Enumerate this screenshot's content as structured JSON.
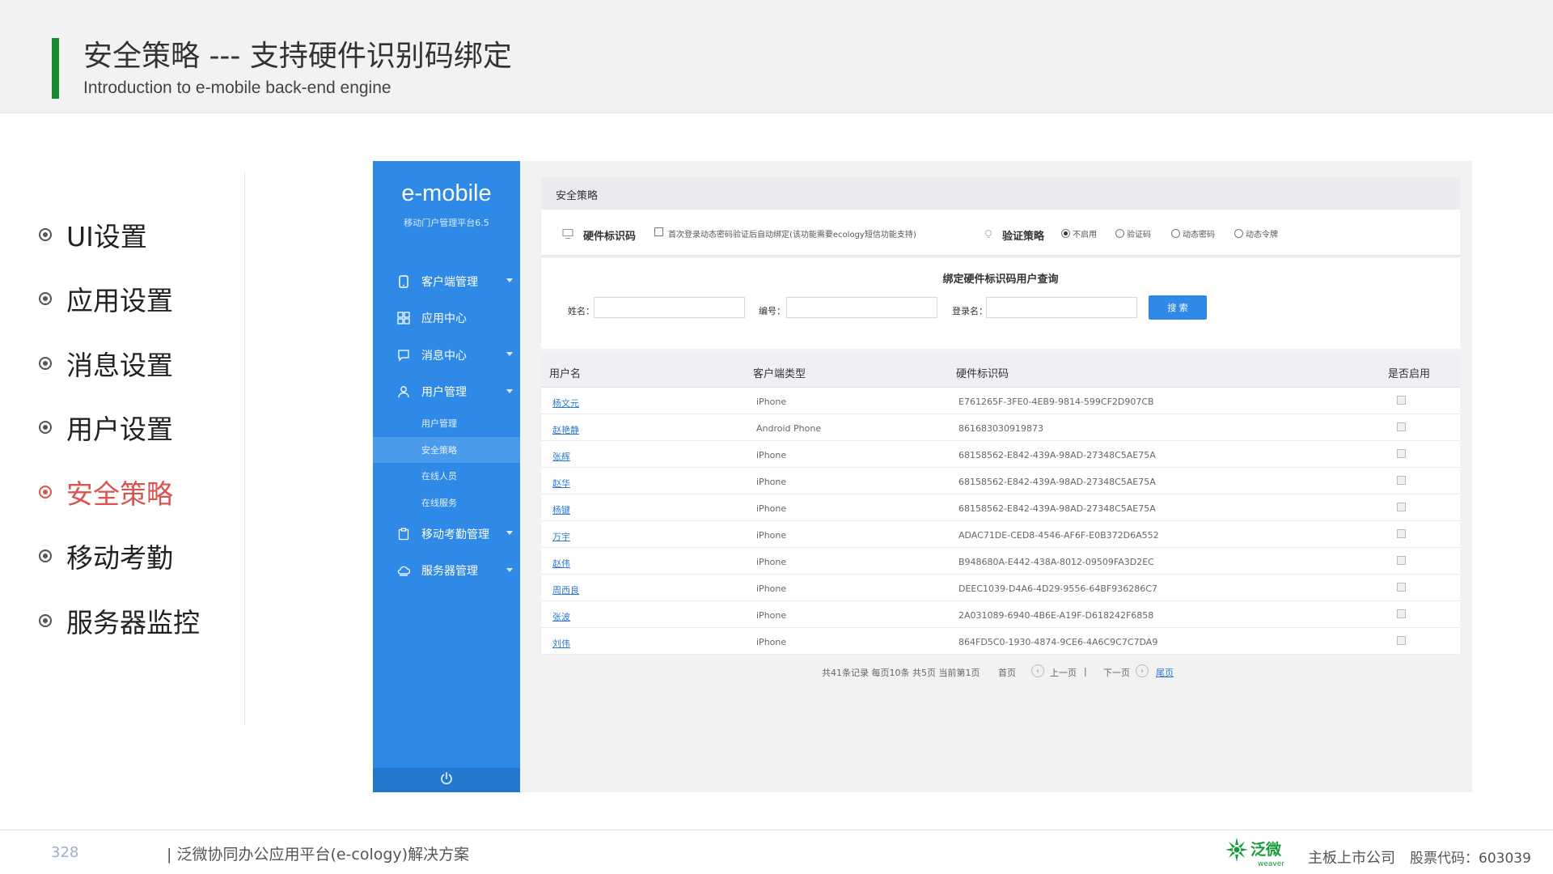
{
  "header": {
    "title": "安全策略 --- 支持硬件识别码绑定",
    "subtitle": "Introduction to e-mobile back-end engine",
    "accent_color": "#1a8a2e"
  },
  "left_nav": {
    "items": [
      {
        "label": "UI设置",
        "active": false
      },
      {
        "label": "应用设置",
        "active": false
      },
      {
        "label": "消息设置",
        "active": false
      },
      {
        "label": "用户设置",
        "active": false
      },
      {
        "label": "安全策略",
        "active": true
      },
      {
        "label": "移动考勤",
        "active": false
      },
      {
        "label": "服务器监控",
        "active": false
      }
    ],
    "active_color": "#d9534f"
  },
  "app": {
    "brand": "e-mobile",
    "brand_sub": "移动门户管理平台6.5",
    "sidebar_color": "#2e8ae6",
    "menu": {
      "client_mgmt": "客户端管理",
      "app_center": "应用中心",
      "msg_center": "消息中心",
      "user_mgmt": "用户管理",
      "sub_user_mgmt": "用户管理",
      "sub_security": "安全策略",
      "sub_online_users": "在线人员",
      "sub_online_service": "在线服务",
      "attendance_mgmt": "移动考勤管理",
      "server_mgmt": "服务器管理"
    },
    "breadcrumb": "安全策略",
    "settings": {
      "hw_label": "硬件标识码",
      "hw_checkbox_text": "首次登录动态密码验证后自动绑定(该功能需要ecology短信功能支持)",
      "verify_label": "验证策略",
      "options": [
        "不启用",
        "验证码",
        "动态密码",
        "动态令牌"
      ],
      "selected_option": "不启用"
    },
    "search": {
      "title": "绑定硬件标识码用户查询",
      "name_label": "姓名：",
      "number_label": "编号：",
      "login_label": "登录名：",
      "button": "搜 索"
    },
    "table": {
      "columns": [
        "用户名",
        "客户端类型",
        "硬件标识码",
        "是否启用"
      ],
      "rows": [
        {
          "user": "杨文元",
          "type": "iPhone",
          "code": "E761265F-3FE0-4EB9-9814-599CF2D907CB"
        },
        {
          "user": "赵艳静",
          "type": "Android Phone",
          "code": "861683030919873"
        },
        {
          "user": "张辉",
          "type": "iPhone",
          "code": "68158562-E842-439A-98AD-27348C5AE75A"
        },
        {
          "user": "赵华",
          "type": "iPhone",
          "code": "68158562-E842-439A-98AD-27348C5AE75A"
        },
        {
          "user": "杨键",
          "type": "iPhone",
          "code": "68158562-E842-439A-98AD-27348C5AE75A"
        },
        {
          "user": "万宇",
          "type": "iPhone",
          "code": "ADAC71DE-CED8-4546-AF6F-E0B372D6A552"
        },
        {
          "user": "赵伟",
          "type": "iPhone",
          "code": "B948680A-E442-438A-8012-09509FA3D2EC"
        },
        {
          "user": "周西良",
          "type": "iPhone",
          "code": "DEEC1039-D4A6-4D29-9556-64BF936286C7"
        },
        {
          "user": "张波",
          "type": "iPhone",
          "code": "2A031089-6940-4B6E-A19F-D618242F6858"
        },
        {
          "user": "刘伟",
          "type": "iPhone",
          "code": "864FD5C0-1930-4874-9CE6-4A6C9C7C7DA9"
        }
      ]
    },
    "pager": {
      "summary": "共41条记录 每页10条 共5页 当前第1页",
      "first": "首页",
      "prev": "上一页",
      "separator": "|",
      "next": "下一页",
      "last": "尾页"
    }
  },
  "footer": {
    "page_number": "328",
    "text": "| 泛微协同办公应用平台(e-cology)解决方案",
    "logo_text": "泛微",
    "logo_sub": "weaver",
    "company": "主板上市公司",
    "stock": "股票代码：603039"
  }
}
